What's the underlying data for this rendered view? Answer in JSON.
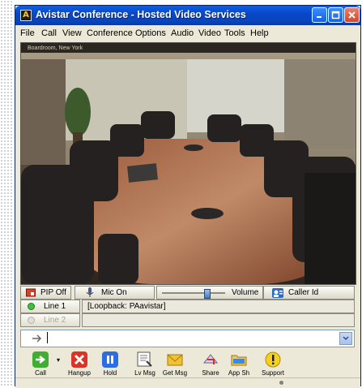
{
  "window": {
    "title": "Avistar Conference - Hosted Video Services",
    "icon_glyph": "A"
  },
  "menu": [
    "File",
    "Call",
    "View",
    "Conference",
    "Options",
    "Audio",
    "Video",
    "Tools",
    "Help"
  ],
  "video": {
    "overlay_label": "Boardroom, New York"
  },
  "controls": {
    "pip": "PIP Off",
    "mic": "Mic On",
    "volume": "Volume",
    "caller_id": "Caller Id",
    "volume_level": 0.7
  },
  "lines": [
    {
      "label": "Line 1",
      "value": "[Loopback: PAavistar]",
      "status": "active",
      "color": "#3fbf3f"
    },
    {
      "label": "Line 2",
      "value": "",
      "status": "inactive",
      "color": "#c9c6b8"
    }
  ],
  "dial": {
    "value": ""
  },
  "toolbar": [
    {
      "label": "Call",
      "icon": "call-arrow-icon"
    },
    {
      "label": "Hangup",
      "icon": "hangup-x-icon"
    },
    {
      "label": "Hold",
      "icon": "hold-pause-icon"
    },
    {
      "label": "Lv Msg",
      "icon": "leave-message-icon"
    },
    {
      "label": "Get Msg",
      "icon": "envelope-icon"
    },
    {
      "label": "Share",
      "icon": "share-icon"
    },
    {
      "label": "App Sh",
      "icon": "folder-icon"
    },
    {
      "label": "Support",
      "icon": "support-icon"
    }
  ],
  "colors": {
    "titlebar": "#0a48c9",
    "window_bg": "#ece9d8",
    "accent_green": "#3fbf3f"
  }
}
